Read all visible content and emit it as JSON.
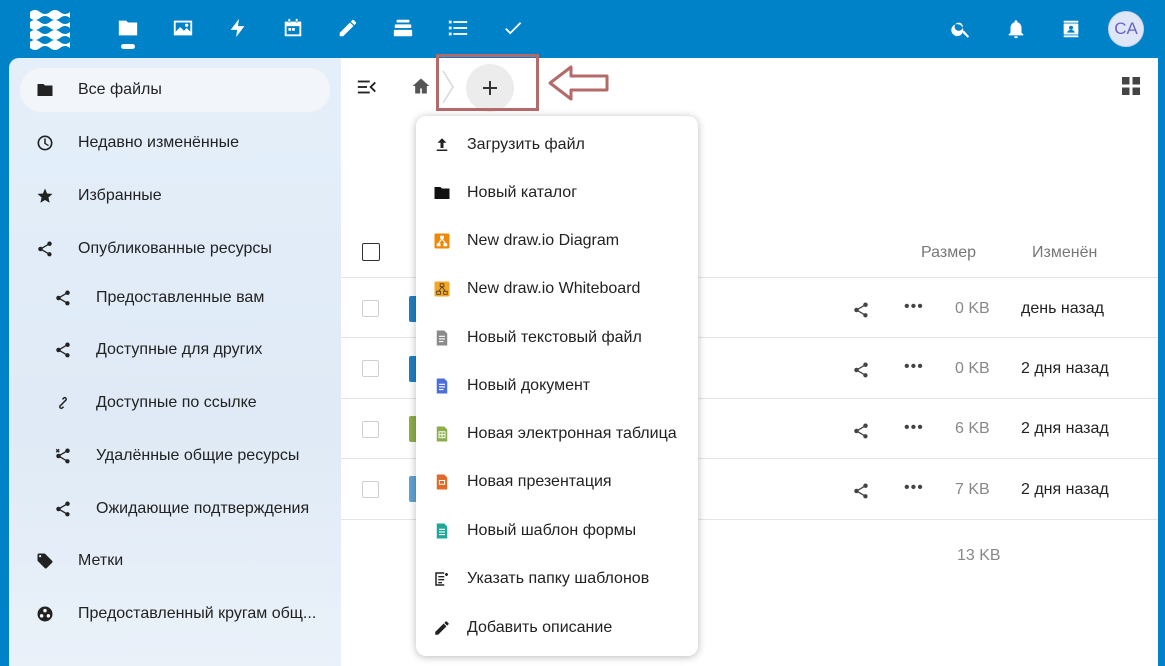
{
  "header": {
    "apps": [
      {
        "name": "files-icon"
      },
      {
        "name": "photos-icon"
      },
      {
        "name": "activity-icon"
      },
      {
        "name": "calendar-icon"
      },
      {
        "name": "notes-icon"
      },
      {
        "name": "deck-icon"
      },
      {
        "name": "tasks-list-icon"
      },
      {
        "name": "tasks-check-icon"
      }
    ],
    "avatar_initials": "CA"
  },
  "sidebar": {
    "items": [
      {
        "label": "Все файлы",
        "icon": "folder-icon"
      },
      {
        "label": "Недавно изменённые",
        "icon": "clock-icon"
      },
      {
        "label": "Избранные",
        "icon": "star-icon"
      },
      {
        "label": "Опубликованные ресурсы",
        "icon": "share-icon"
      },
      {
        "label": "Предоставленные вам",
        "icon": "share-icon"
      },
      {
        "label": "Доступные для других",
        "icon": "share-icon"
      },
      {
        "label": "Доступные по ссылке",
        "icon": "link-icon"
      },
      {
        "label": "Удалённые общие ресурсы",
        "icon": "share-remove-icon"
      },
      {
        "label": "Ожидающие подтверждения",
        "icon": "share-icon"
      },
      {
        "label": "Метки",
        "icon": "tag-icon"
      },
      {
        "label": "Предоставленный кругам общ...",
        "icon": "circles-icon"
      }
    ]
  },
  "files": {
    "columns": {
      "size": "Размер",
      "modified": "Изменён"
    },
    "rows": [
      {
        "size": "0 KB",
        "modified": "день назад",
        "color": "#1e7fc1"
      },
      {
        "size": "0 KB",
        "modified": "2 дня назад",
        "color": "#1e7fc1"
      },
      {
        "size": "6 KB",
        "modified": "2 дня назад",
        "color": "#8cae4a"
      },
      {
        "size": "7 KB",
        "modified": "2 дня назад",
        "color": "#5fa3d3"
      }
    ],
    "total_size": "13 KB"
  },
  "new_menu": {
    "items": [
      {
        "label": "Загрузить файл",
        "icon": "upload-icon"
      },
      {
        "label": "Новый каталог",
        "icon": "folder-icon"
      },
      {
        "label": "New draw.io Diagram",
        "icon": "drawio-diagram-icon"
      },
      {
        "label": "New draw.io Whiteboard",
        "icon": "drawio-whiteboard-icon"
      },
      {
        "label": "Новый текстовый файл",
        "icon": "text-file-icon"
      },
      {
        "label": "Новый документ",
        "icon": "document-icon"
      },
      {
        "label": "Новая электронная таблица",
        "icon": "spreadsheet-icon"
      },
      {
        "label": "Новая презентация",
        "icon": "presentation-icon"
      },
      {
        "label": "Новый шаблон формы",
        "icon": "form-template-icon"
      },
      {
        "label": "Указать папку шаблонов",
        "icon": "template-folder-icon"
      },
      {
        "label": "Добавить описание",
        "icon": "pencil-icon"
      }
    ]
  },
  "colors": {
    "brand": "#0082c9",
    "annotation": "#b56a6a"
  }
}
